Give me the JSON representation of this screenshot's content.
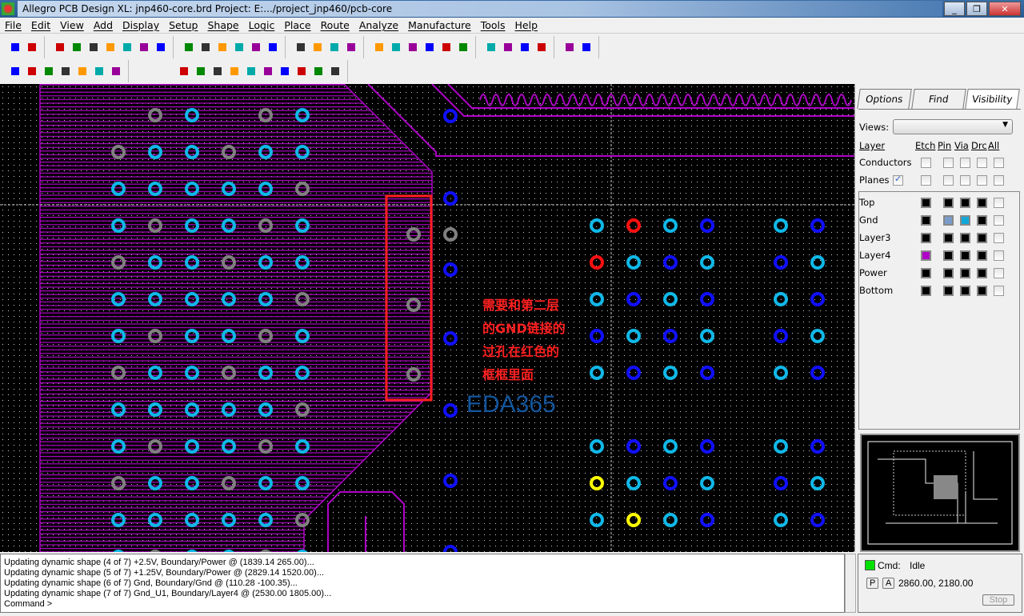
{
  "window": {
    "title": "Allegro PCB Design XL: jnp460-core.brd  Project: E:.../project_jnp460/pcb-core",
    "buttons": [
      "minimize",
      "restore",
      "close"
    ]
  },
  "menu": [
    "File",
    "Edit",
    "View",
    "Add",
    "Display",
    "Setup",
    "Shape",
    "Logic",
    "Place",
    "Route",
    "Analyze",
    "Manufacture",
    "Tools",
    "Help"
  ],
  "toolbar1": [
    {
      "group": "file",
      "icons": [
        "open-icon",
        "save-icon"
      ]
    },
    {
      "group": "edit",
      "icons": [
        "move-icon",
        "copy-icon",
        "delete-icon",
        "undo-icon",
        "redo-icon",
        "fix-icon",
        "unfix-icon"
      ]
    },
    {
      "group": "zoom",
      "icons": [
        "zoom-points-icon",
        "zoom-fit-icon",
        "zoom-in-icon",
        "zoom-out-icon",
        "zoom-world-icon",
        "redraw-icon"
      ]
    },
    {
      "group": "add",
      "icons": [
        "add-line-icon",
        "add-rect-icon",
        "add-text-icon",
        "edit-text-icon"
      ]
    },
    {
      "group": "display",
      "icons": [
        "color-icon",
        "layer-icon",
        "info-icon",
        "measure-icon",
        "highlight-icon",
        "dehighlight-icon"
      ]
    },
    {
      "group": "grid",
      "icons": [
        "grid-icon",
        "layers-icon",
        "shadow-icon",
        "swap-icon"
      ]
    },
    {
      "group": "drc",
      "icons": [
        "drc-icon",
        "waive-icon"
      ]
    }
  ],
  "toolbar2": [
    {
      "group": "route",
      "icons": [
        "ratsnest-off-icon",
        "ratsnest-on-icon",
        "add-connect-icon",
        "slide-icon",
        "delay-tune-icon",
        "custom-smooth-icon",
        "spread-icon"
      ]
    },
    {
      "group": "shape",
      "icons": [
        "shape-add-icon",
        "shape-rect-icon",
        "shape-circle-icon",
        "select-icon",
        "shape-edit-icon",
        "shape-void-icon",
        "shape-void-rect-icon",
        "shape-void-circle-icon",
        "shape-merge-icon",
        "shape-check-icon"
      ]
    }
  ],
  "annotation": {
    "text": "需要和第二层的GND链接的过孔在红色的框框里面",
    "box_color": "#ff2020"
  },
  "watermark": "EDA365",
  "colors": {
    "background": "#000000",
    "plane": "#b000c8",
    "via_cyan": "#10b8e8",
    "via_gray": "#808080",
    "via_blue": "#1010ff",
    "via_red": "#ff1010",
    "via_yellow": "#ffff00"
  },
  "panel": {
    "tabs": [
      "Options",
      "Find",
      "Visibility"
    ],
    "active_tab": "Visibility",
    "views_label": "Views:",
    "views_value": "",
    "columns": [
      "Layer",
      "Etch",
      "Pin",
      "Via",
      "Drc",
      "All"
    ],
    "groups": [
      {
        "name": "Conductors",
        "checked": false
      },
      {
        "name": "Planes",
        "checked": true
      }
    ],
    "layers": [
      {
        "name": "Top",
        "colors": [
          "#000000",
          "#000000",
          "#000000",
          "#000000"
        ]
      },
      {
        "name": "Gnd",
        "colors": [
          "#000000",
          "#7b9cc8",
          "#10a8d8",
          "#000000"
        ]
      },
      {
        "name": "Layer3",
        "colors": [
          "#000000",
          "#000000",
          "#000000",
          "#000000"
        ]
      },
      {
        "name": "Layer4",
        "colors": [
          "#b000c8",
          "#000000",
          "#000000",
          "#000000"
        ]
      },
      {
        "name": "Power",
        "colors": [
          "#000000",
          "#000000",
          "#000000",
          "#000000"
        ]
      },
      {
        "name": "Bottom",
        "colors": [
          "#000000",
          "#000000",
          "#000000",
          "#000000"
        ]
      }
    ]
  },
  "console": {
    "lines": [
      "Updating dynamic shape (4 of 7) +2.5V, Boundary/Power @ (1839.14 265.00)...",
      "Updating dynamic shape (5 of 7) +1.25V, Boundary/Power @ (2829.14 1520.00)...",
      "Updating dynamic shape (6 of 7) Gnd, Boundary/Gnd @ (110.28 -100.35)...",
      "Updating dynamic shape (7 of 7) Gnd_U1, Boundary/Layer4 @ (2530.00 1805.00)...",
      "Command >"
    ]
  },
  "status": {
    "cmd_label": "Cmd:",
    "cmd_value": "Idle",
    "cmd_color": "#00e000",
    "p_label": "P",
    "a_label": "A",
    "coords": "2860.00, 2180.00",
    "stop_label": "Stop"
  }
}
